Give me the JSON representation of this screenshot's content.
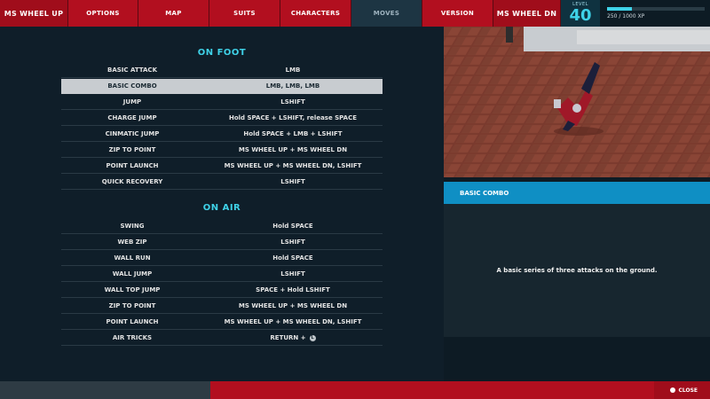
{
  "nav": {
    "left": "MS WHEEL UP",
    "tabs": [
      "OPTIONS",
      "MAP",
      "SUITS",
      "CHARACTERS",
      "MOVES",
      "VERSION"
    ],
    "right": "MS WHEEL DN",
    "active_index": 4
  },
  "level": {
    "label": "LEVEL",
    "value": "40"
  },
  "xp": {
    "text": "250 / 1000 XP",
    "fraction": 0.25
  },
  "on_foot": {
    "title": "ON FOOT",
    "moves": [
      {
        "name": "BASIC ATTACK",
        "keys": "LMB"
      },
      {
        "name": "BASIC COMBO",
        "keys": "LMB, LMB, LMB"
      },
      {
        "name": "JUMP",
        "keys": "LSHIFT"
      },
      {
        "name": "CHARGE JUMP",
        "keys": "Hold SPACE + LSHIFT, release SPACE"
      },
      {
        "name": "CINMATIC JUMP",
        "keys": "Hold SPACE + LMB + LSHIFT"
      },
      {
        "name": "ZIP TO POINT",
        "keys": "MS WHEEL UP + MS WHEEL DN"
      },
      {
        "name": "POINT LAUNCH",
        "keys": "MS WHEEL UP + MS WHEEL DN, LSHIFT"
      },
      {
        "name": "QUICK RECOVERY",
        "keys": "LSHIFT"
      }
    ]
  },
  "on_air": {
    "title": "ON AIR",
    "moves": [
      {
        "name": "SWING",
        "keys": "Hold SPACE"
      },
      {
        "name": "WEB ZIP",
        "keys": "LSHIFT"
      },
      {
        "name": "WALL RUN",
        "keys": "Hold SPACE"
      },
      {
        "name": "WALL JUMP",
        "keys": "LSHIFT"
      },
      {
        "name": "WALL TOP JUMP",
        "keys": "SPACE + Hold LSHIFT"
      },
      {
        "name": "ZIP TO POINT",
        "keys": "MS WHEEL UP + MS WHEEL DN"
      },
      {
        "name": "POINT LAUNCH",
        "keys": "MS WHEEL UP + MS WHEEL DN, LSHIFT"
      },
      {
        "name": "AIR TRICKS",
        "keys": "RETURN +",
        "glyph": "L"
      }
    ]
  },
  "selected": {
    "section": "on_foot",
    "index": 1
  },
  "info": {
    "header": "BASIC COMBO",
    "description": "A basic series of three attacks on the ground."
  },
  "bottom": {
    "close_label": "CLOSE"
  },
  "colors": {
    "accent_cyan": "#3fd2e8",
    "nav_red": "#b20f1f",
    "info_blue": "#0f8fc4"
  }
}
